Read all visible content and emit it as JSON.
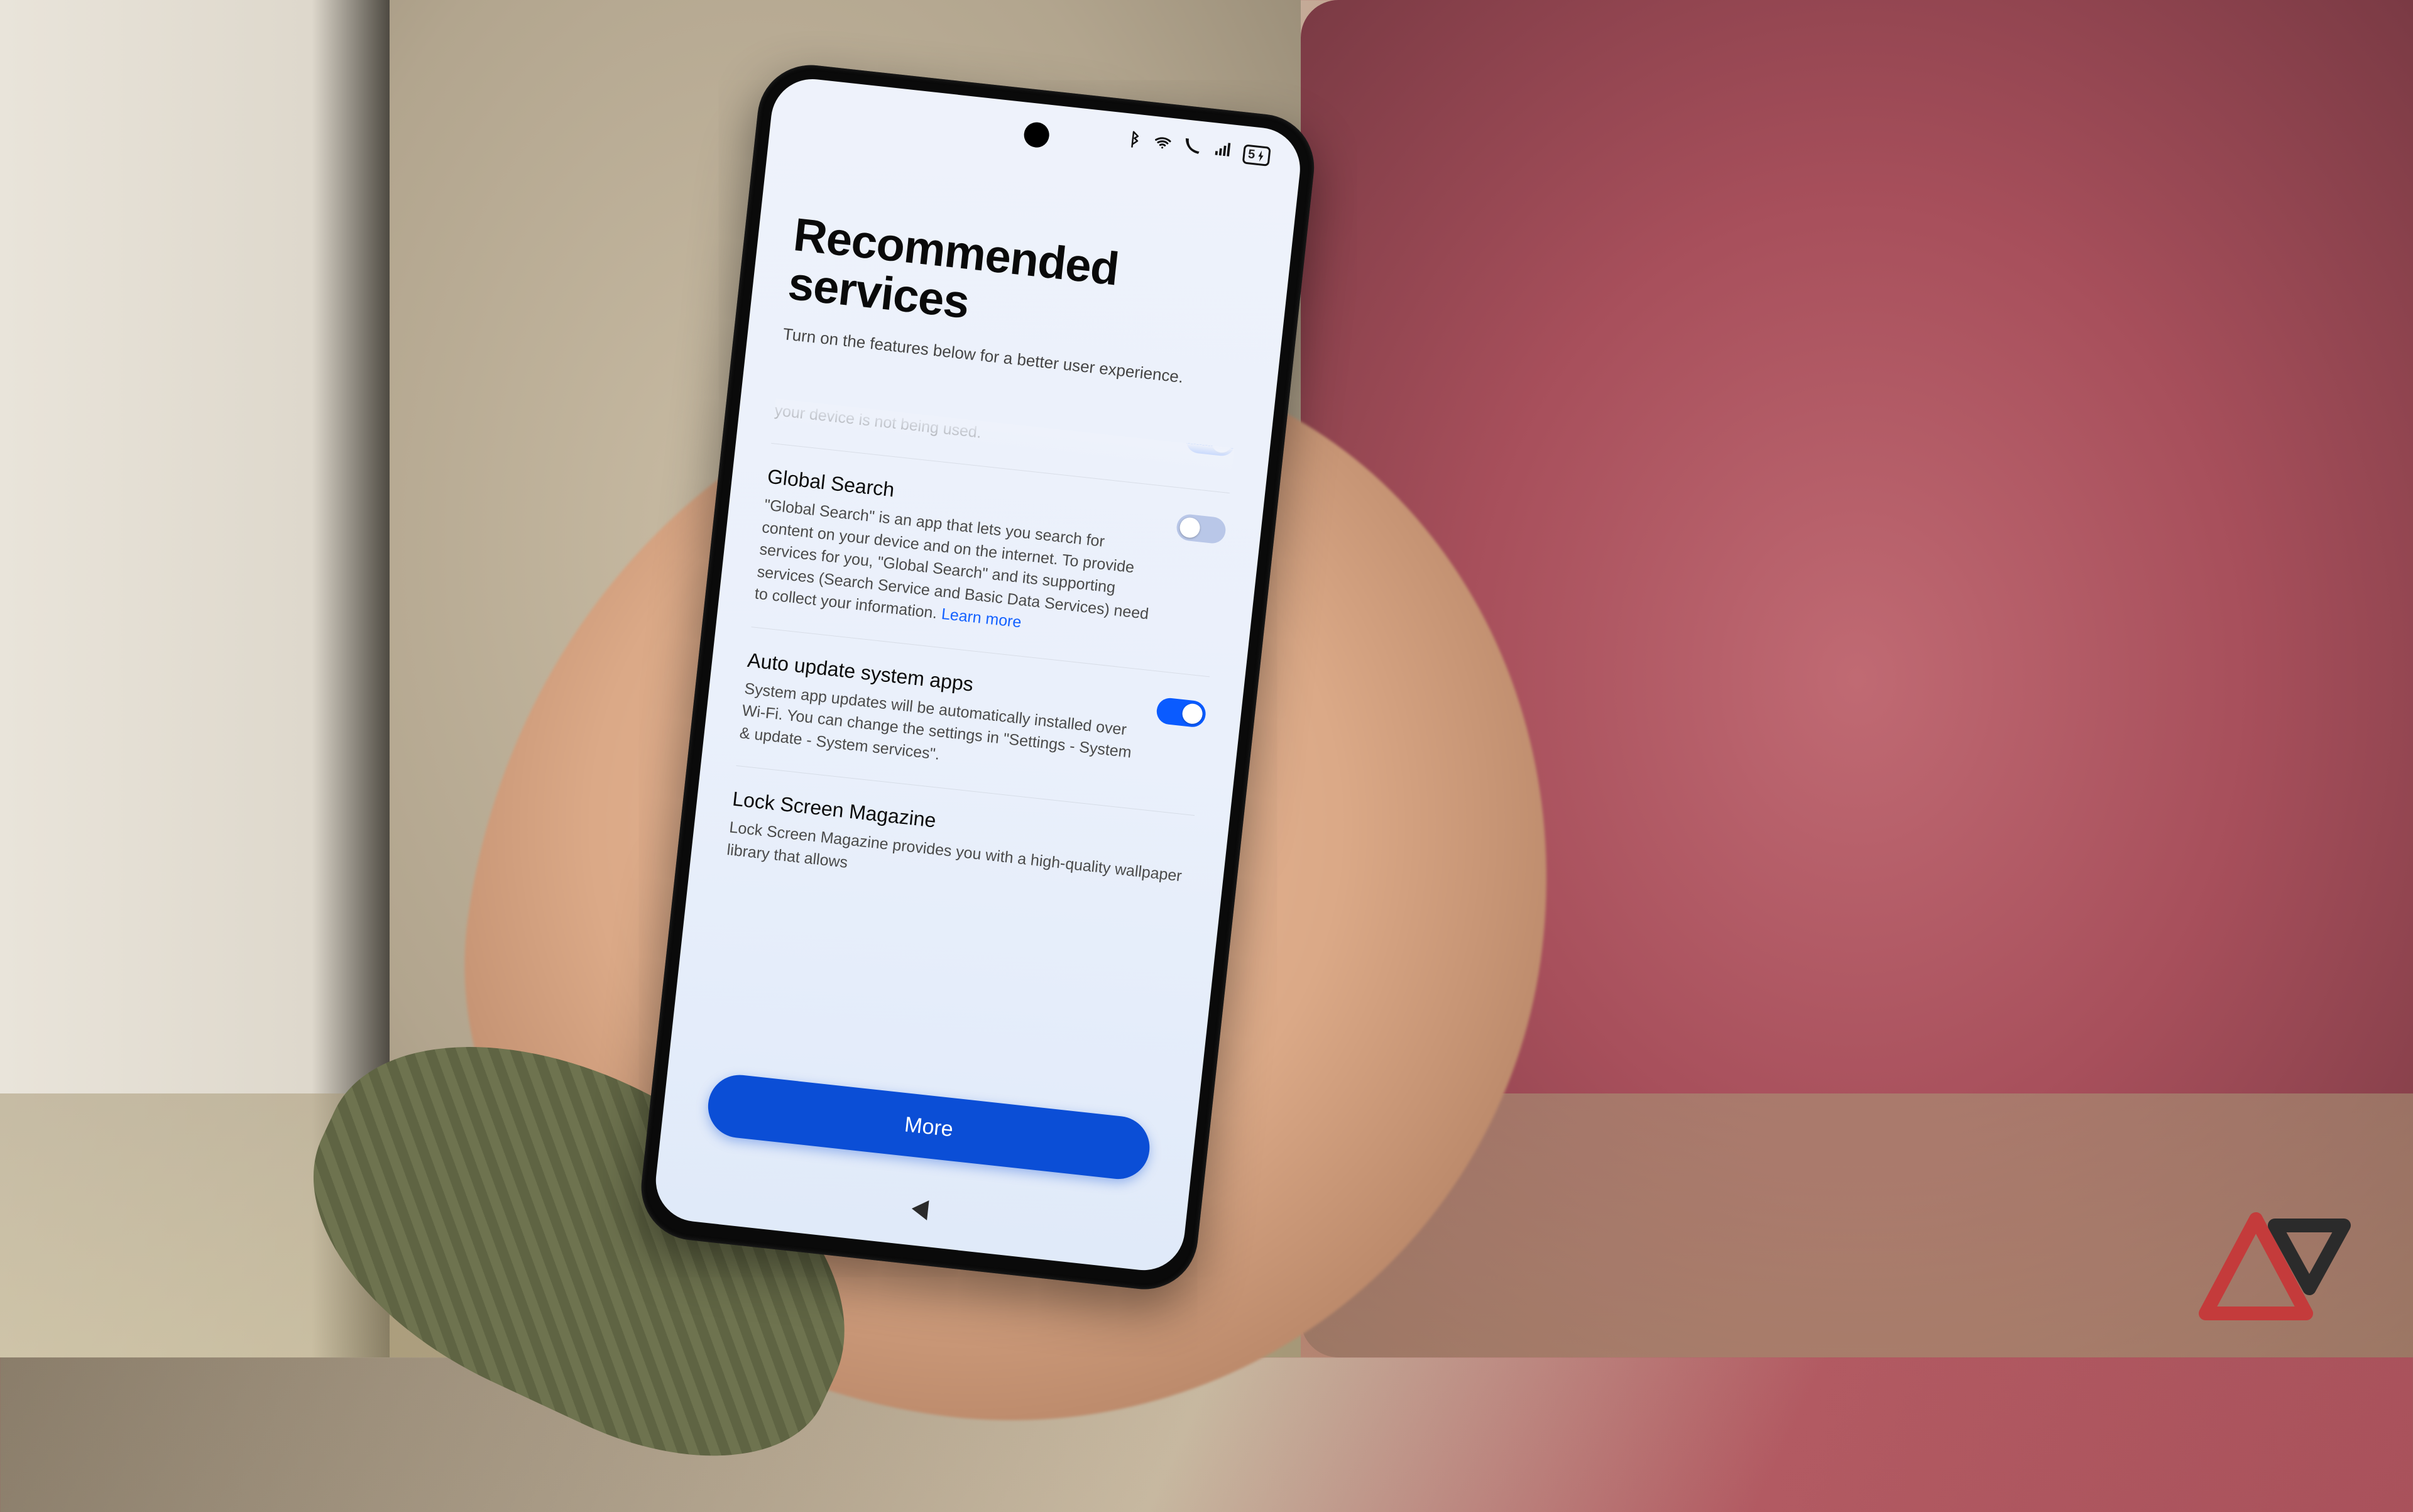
{
  "status_bar": {
    "battery_text": "5"
  },
  "page": {
    "title": "Recommended services",
    "subtitle": "Turn on the features below for a better user experience."
  },
  "items": [
    {
      "title": "",
      "desc": "Your system will be automatically updated at night when your device is not being used.",
      "toggle": "on"
    },
    {
      "title": "Global Search",
      "desc": "\"Global Search\" is an app that lets you search for content on your device and on the internet. To provide services for you, \"Global Search\" and its supporting services (Search Service and Basic Data Services) need to collect your information. ",
      "learn_more": "Learn more",
      "toggle": "off"
    },
    {
      "title": "Auto update system apps",
      "desc": "System app updates will be automatically installed over Wi-Fi. You can change the settings in \"Settings - System & update - System services\".",
      "toggle": "on"
    },
    {
      "title": "Lock Screen Magazine",
      "desc": "Lock Screen Magazine provides you with a high-quality wallpaper library that allows",
      "toggle": null
    }
  ],
  "more_button": "More",
  "colors": {
    "accent": "#0b4ed6",
    "toggle_on": "#0a5bff",
    "toggle_off": "#b9c7e8",
    "link": "#1461ff"
  }
}
